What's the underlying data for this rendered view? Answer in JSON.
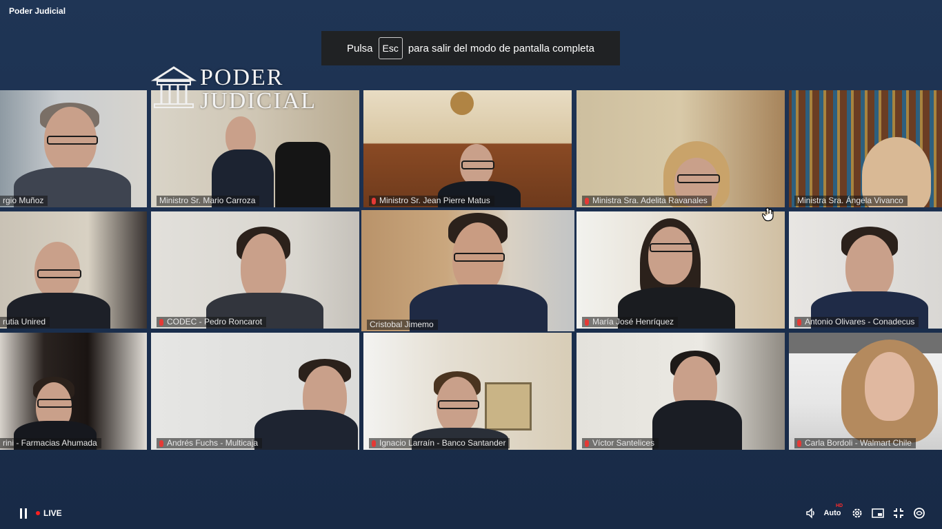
{
  "channel": {
    "title": "Poder Judicial"
  },
  "banner": {
    "prefix": "Pulsa",
    "key": "Esc",
    "suffix": "para salir del modo de pantalla completa"
  },
  "logo": {
    "line1": "PODER",
    "line2": "JUDICIAL"
  },
  "participants": [
    {
      "name": "rgio Muñoz"
    },
    {
      "name": "Ministro Sr. Mario Carroza"
    },
    {
      "name": "Ministro Sr. Jean Pierre Matus"
    },
    {
      "name": "Ministra Sra. Adelita Ravanales"
    },
    {
      "name": "Ministra Sra. Ángela Vivanco"
    },
    {
      "name": "rutia Unired"
    },
    {
      "name": "CODEC - Pedro Roncarot"
    },
    {
      "name": "Cristobal Jimemo"
    },
    {
      "name": "María José Henríquez"
    },
    {
      "name": "Antonio Olivares - Conadecus"
    },
    {
      "name": "rini - Farmacias Ahumada"
    },
    {
      "name": "Andrés Fuchs - Multicaja"
    },
    {
      "name": "Ignacio Larraín - Banco Santander"
    },
    {
      "name": "Víctor Santelices"
    },
    {
      "name": "Carla Bordoli - Walmart Chile"
    }
  ],
  "active_speaker_index": 7,
  "controls": {
    "live_label": "LIVE",
    "quality_label": "Auto",
    "hd_badge": "HD",
    "icons": [
      "pause-icon",
      "volume-icon",
      "settings-gear-icon",
      "miniplayer-icon",
      "exit-fullscreen-icon",
      "brand-icon"
    ]
  },
  "colors": {
    "active_border": "#e1e54a",
    "live_dot": "#ff1f1f",
    "mic_muted": "#e53935"
  }
}
